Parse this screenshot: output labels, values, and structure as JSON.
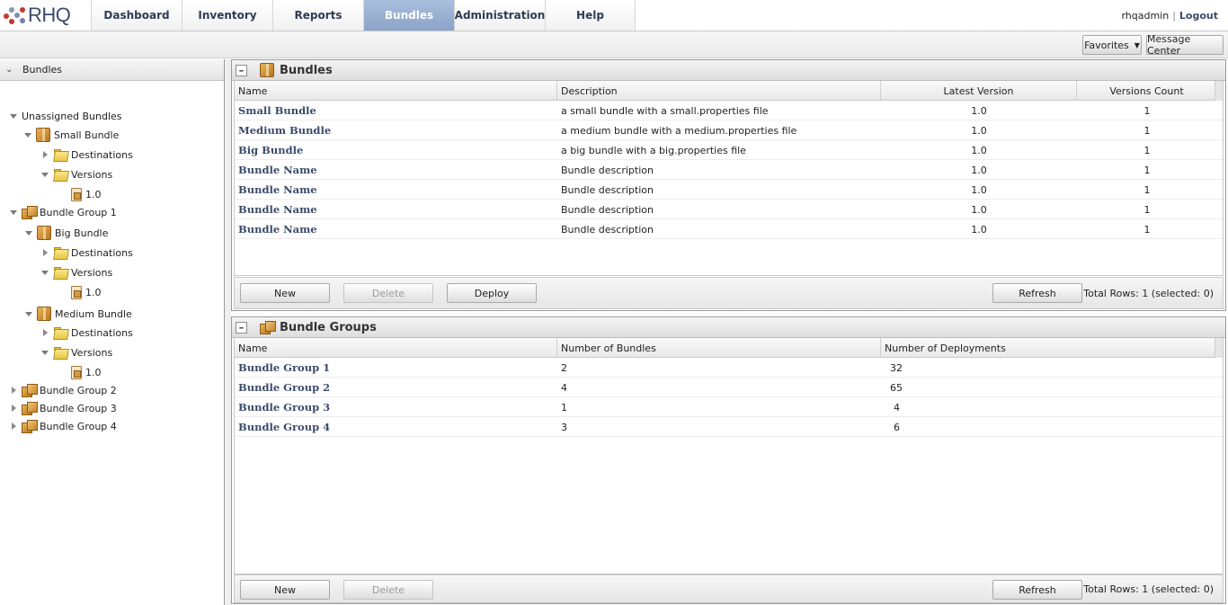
{
  "app": {
    "logo_text": "RHQ"
  },
  "nav": {
    "items": [
      {
        "label": "Dashboard",
        "active": false
      },
      {
        "label": "Inventory",
        "active": false
      },
      {
        "label": "Reports",
        "active": false
      },
      {
        "label": "Bundles",
        "active": true
      },
      {
        "label": "Administration",
        "active": false
      },
      {
        "label": "Help",
        "active": false
      }
    ],
    "active_color": "#8aa4c8"
  },
  "user": {
    "name": "rhqadmin",
    "separator": "|",
    "logout_label": "Logout"
  },
  "subbar": {
    "favorites_label": "Favorites",
    "message_center_label": "Message Center"
  },
  "left_panel": {
    "title": "Bundles",
    "tree": [
      {
        "label": "Unassigned Bundles",
        "icon": "none",
        "toggle": "expanded"
      },
      {
        "label": "Small Bundle",
        "icon": "bundle-icon",
        "toggle": "expanded"
      },
      {
        "label": "Destinations",
        "icon": "folder-icon",
        "toggle": "collapsed"
      },
      {
        "label": "Versions",
        "icon": "folder-icon",
        "toggle": "expanded"
      },
      {
        "label": "1.0",
        "icon": "bundle-version-icon",
        "toggle": "none"
      },
      {
        "label": "Bundle Group 1",
        "icon": "bundle-group-icon",
        "toggle": "expanded"
      },
      {
        "label": "Big Bundle",
        "icon": "bundle-icon",
        "toggle": "expanded"
      },
      {
        "label": "Destinations",
        "icon": "folder-icon",
        "toggle": "collapsed"
      },
      {
        "label": "Versions",
        "icon": "folder-icon",
        "toggle": "expanded"
      },
      {
        "label": "1.0",
        "icon": "bundle-version-icon",
        "toggle": "none"
      },
      {
        "label": "Medium Bundle",
        "icon": "bundle-icon",
        "toggle": "expanded"
      },
      {
        "label": "Destinations",
        "icon": "folder-icon",
        "toggle": "collapsed"
      },
      {
        "label": "Versions",
        "icon": "folder-icon",
        "toggle": "expanded"
      },
      {
        "label": "1.0",
        "icon": "bundle-version-icon",
        "toggle": "none"
      },
      {
        "label": "Bundle Group 2",
        "icon": "bundle-group-icon",
        "toggle": "collapsed"
      },
      {
        "label": "Bundle Group 3",
        "icon": "bundle-group-icon",
        "toggle": "collapsed"
      },
      {
        "label": "Bundle Group 4",
        "icon": "bundle-group-icon",
        "toggle": "collapsed"
      }
    ]
  },
  "bundles_panel": {
    "title": "Bundles",
    "columns": [
      "Name",
      "Description",
      "Latest Version",
      "Versions Count"
    ],
    "rows": [
      {
        "name": "Small Bundle",
        "description": "a small bundle with a small.properties file",
        "latest_version": "1.0",
        "versions_count": "1"
      },
      {
        "name": "Medium Bundle",
        "description": "a medium bundle with a medium.properties file",
        "latest_version": "1.0",
        "versions_count": "1"
      },
      {
        "name": "Big Bundle",
        "description": "a big bundle with a big.properties file",
        "latest_version": "1.0",
        "versions_count": "1"
      },
      {
        "name": "Bundle Name",
        "description": "Bundle description",
        "latest_version": "1.0",
        "versions_count": "1"
      },
      {
        "name": "Bundle Name",
        "description": "Bundle description",
        "latest_version": "1.0",
        "versions_count": "1"
      },
      {
        "name": "Bundle Name",
        "description": "Bundle description",
        "latest_version": "1.0",
        "versions_count": "1"
      },
      {
        "name": "Bundle Name",
        "description": "Bundle description",
        "latest_version": "1.0",
        "versions_count": "1"
      }
    ],
    "buttons": {
      "new": "New",
      "delete": "Delete",
      "deploy": "Deploy",
      "refresh": "Refresh"
    },
    "total_rows": "Total Rows: 1 (selected: 0)"
  },
  "groups_panel": {
    "title": "Bundle Groups",
    "columns": [
      "Name",
      "Number of Bundles",
      "Number of Deployments"
    ],
    "rows": [
      {
        "name": "Bundle Group 1",
        "bundles": "2",
        "deployments": "32"
      },
      {
        "name": "Bundle Group 2",
        "bundles": "4",
        "deployments": "65"
      },
      {
        "name": "Bundle Group 3",
        "bundles": "1",
        "deployments": "4"
      },
      {
        "name": "Bundle Group 4",
        "bundles": "3",
        "deployments": "6"
      }
    ],
    "buttons": {
      "new": "New",
      "delete": "Delete",
      "refresh": "Refresh"
    },
    "total_rows": "Total Rows: 1 (selected: 0)"
  },
  "colors": {
    "link": "#3b4b6b",
    "disabled_text": "#9a9a9a"
  }
}
